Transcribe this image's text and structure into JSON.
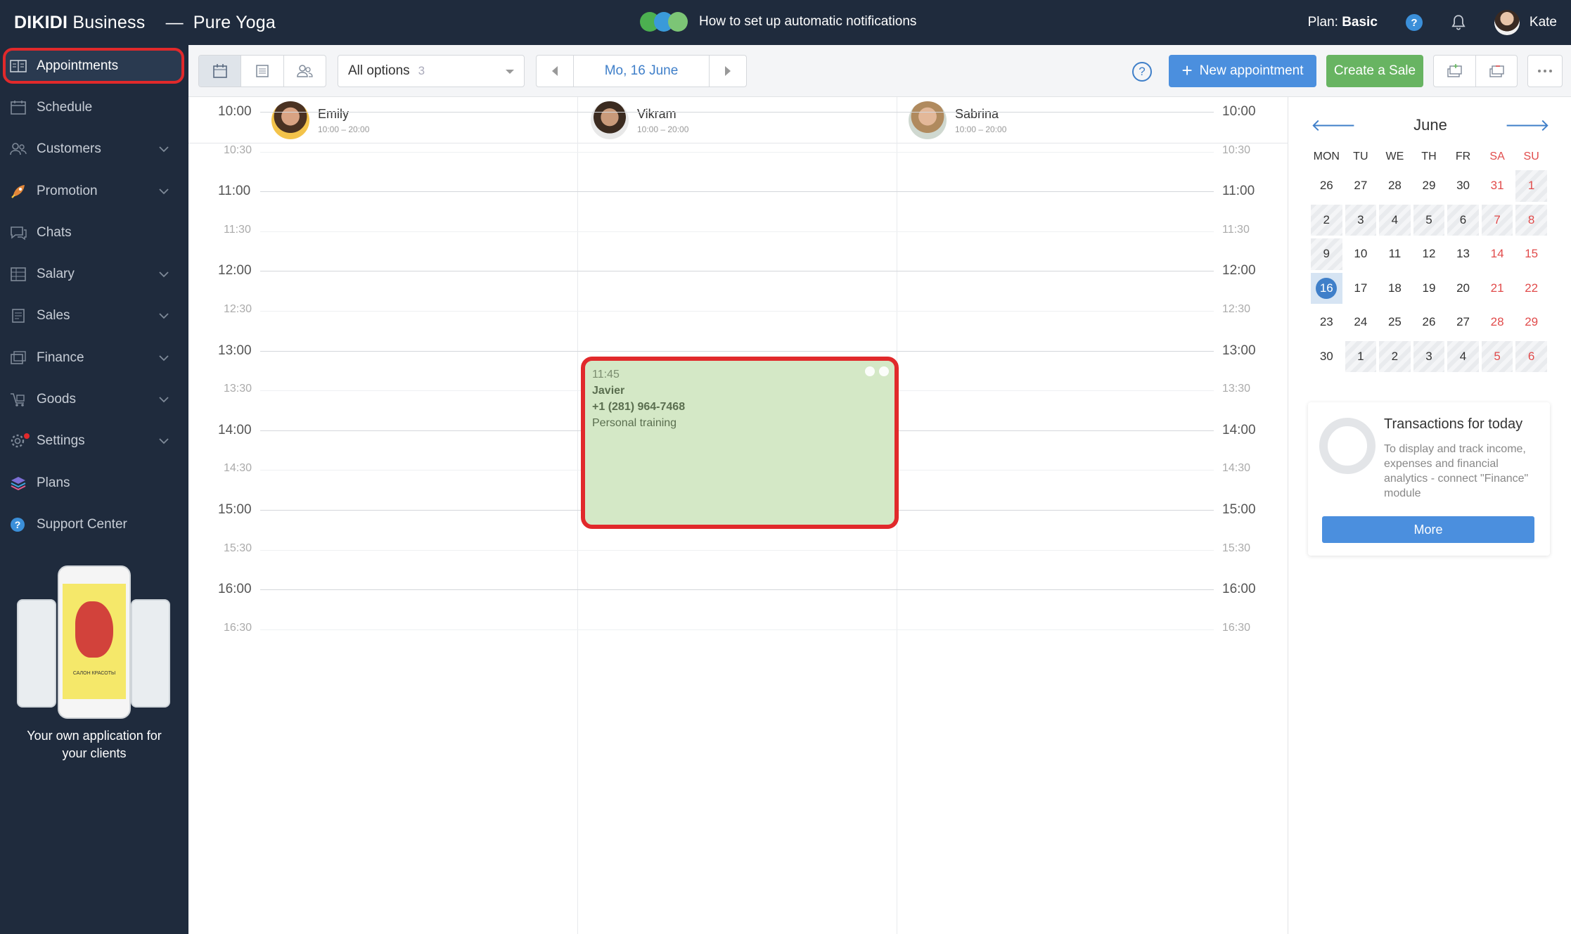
{
  "topbar": {
    "brand": "DIKIDI",
    "brand_suffix": "Business",
    "dash": "—",
    "company": "Pure Yoga",
    "promo_text": "How to set up automatic notifications",
    "plan_label": "Plan:",
    "plan_value": "Basic",
    "help_glyph": "?",
    "user_name": "Kate"
  },
  "sidebar": {
    "items": [
      {
        "label": "Appointments",
        "icon": "appointments-icon"
      },
      {
        "label": "Schedule",
        "icon": "schedule-icon"
      },
      {
        "label": "Customers",
        "icon": "customers-icon"
      },
      {
        "label": "Promotion",
        "icon": "rocket-icon"
      },
      {
        "label": "Chats",
        "icon": "chat-icon"
      },
      {
        "label": "Salary",
        "icon": "salary-icon"
      },
      {
        "label": "Sales",
        "icon": "sales-icon"
      },
      {
        "label": "Finance",
        "icon": "finance-icon"
      },
      {
        "label": "Goods",
        "icon": "goods-icon"
      },
      {
        "label": "Settings",
        "icon": "gear-icon"
      },
      {
        "label": "Plans",
        "icon": "layers-icon"
      },
      {
        "label": "Support Center",
        "icon": "help-icon"
      }
    ],
    "app_promo": "Your own application for your clients",
    "phone_tag": "САЛОН КРАСОТЫ"
  },
  "toolbar": {
    "filter_label": "All options",
    "filter_count": "3",
    "date_label": "Mo, 16 June",
    "help_glyph": "?",
    "new_appointment": "New appointment",
    "plus_glyph": "+",
    "create_sale": "Create a Sale"
  },
  "calendar": {
    "staff": [
      {
        "name": "Emily",
        "hours": "10:00 – 20:00"
      },
      {
        "name": "Vikram",
        "hours": "10:00 – 20:00"
      },
      {
        "name": "Sabrina",
        "hours": "10:00 – 20:00"
      }
    ],
    "times": [
      "10:00",
      "10:30",
      "11:00",
      "11:30",
      "12:00",
      "12:30",
      "13:00",
      "13:30",
      "14:00",
      "14:30",
      "15:00",
      "15:30",
      "16:00",
      "16:30"
    ],
    "appointment": {
      "time": "11:45",
      "client": "Javier",
      "phone": "+1 (281) 964-7468",
      "service": "Personal training"
    }
  },
  "mini_calendar": {
    "month": "June",
    "prev_glyph": "🡐",
    "next_glyph": "🡒",
    "dow": [
      "MON",
      "TU",
      "WE",
      "TH",
      "FR",
      "SA",
      "SU"
    ],
    "weeks": [
      [
        "26",
        "27",
        "28",
        "29",
        "30",
        "31",
        "1"
      ],
      [
        "2",
        "3",
        "4",
        "5",
        "6",
        "7",
        "8"
      ],
      [
        "9",
        "10",
        "11",
        "12",
        "13",
        "14",
        "15"
      ],
      [
        "16",
        "17",
        "18",
        "19",
        "20",
        "21",
        "22"
      ],
      [
        "23",
        "24",
        "25",
        "26",
        "27",
        "28",
        "29"
      ],
      [
        "30",
        "1",
        "2",
        "3",
        "4",
        "5",
        "6"
      ]
    ],
    "today": "16"
  },
  "transactions": {
    "title": "Transactions for today",
    "text": "To display and track income, expenses and financial analytics - connect \"Finance\" module",
    "button": "More"
  },
  "colors": {
    "dark_bg": "#1f2b3d",
    "accent_blue": "#4b8fde",
    "accent_green": "#68b462",
    "highlight_red": "#e1292b",
    "appointment_bg": "#d4e8c6"
  }
}
